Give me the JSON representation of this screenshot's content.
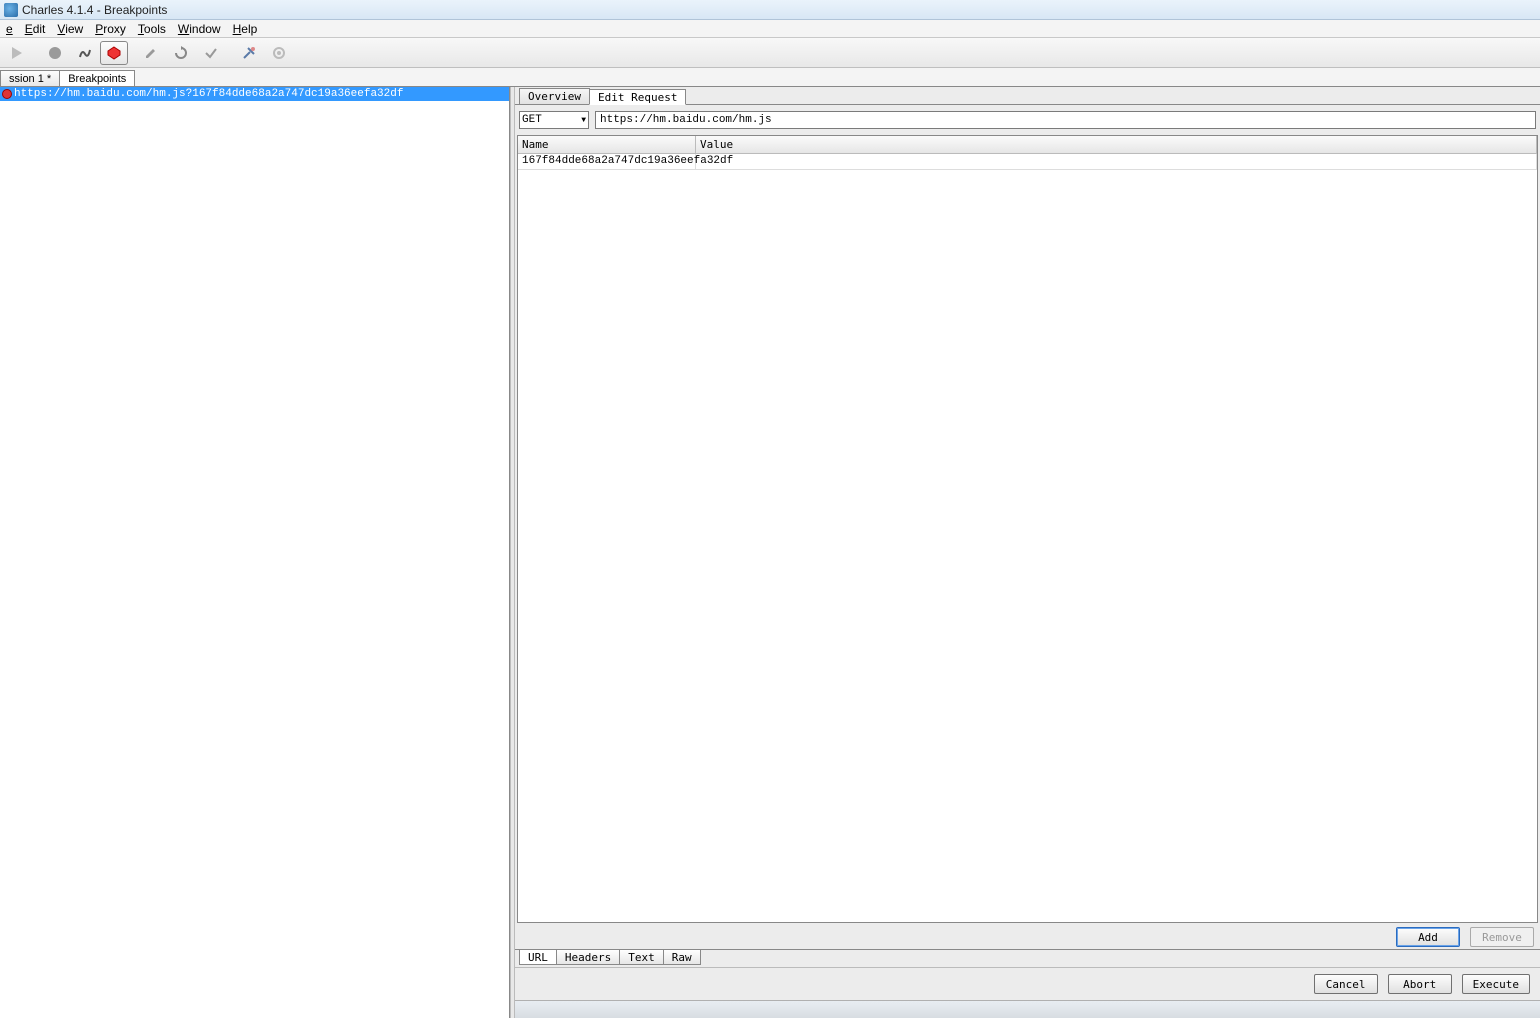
{
  "window": {
    "title": "Charles 4.1.4 - Breakpoints"
  },
  "menu": {
    "items": [
      {
        "underline": "e",
        "rest": ""
      },
      {
        "underline": "E",
        "rest": "dit"
      },
      {
        "underline": "V",
        "rest": "iew"
      },
      {
        "underline": "P",
        "rest": "roxy"
      },
      {
        "underline": "T",
        "rest": "ools"
      },
      {
        "underline": "W",
        "rest": "indow"
      },
      {
        "underline": "H",
        "rest": "elp"
      }
    ]
  },
  "mainTabs": {
    "items": [
      {
        "label": "ssion 1 *",
        "active": false
      },
      {
        "label": "Breakpoints",
        "active": true
      }
    ]
  },
  "leftPane": {
    "entries": [
      {
        "url": "https://hm.baidu.com/hm.js?167f84dde68a2a747dc19a36eefa32df"
      }
    ]
  },
  "rightTabs": {
    "items": [
      {
        "label": "Overview",
        "active": false
      },
      {
        "label": "Edit Request",
        "active": true
      }
    ]
  },
  "request": {
    "method": "GET",
    "url": "https://hm.baidu.com/hm.js"
  },
  "paramTable": {
    "headers": {
      "name": "Name",
      "value": "Value"
    },
    "rows": [
      {
        "name": "167f84dde68a2a747dc19a36eefa32df",
        "value": ""
      }
    ]
  },
  "buttons": {
    "add": "Add",
    "remove": "Remove",
    "cancel": "Cancel",
    "abort": "Abort",
    "execute": "Execute"
  },
  "bottomTabs": {
    "items": [
      {
        "label": "URL",
        "active": true
      },
      {
        "label": "Headers",
        "active": false
      },
      {
        "label": "Text",
        "active": false
      },
      {
        "label": "Raw",
        "active": false
      }
    ]
  }
}
